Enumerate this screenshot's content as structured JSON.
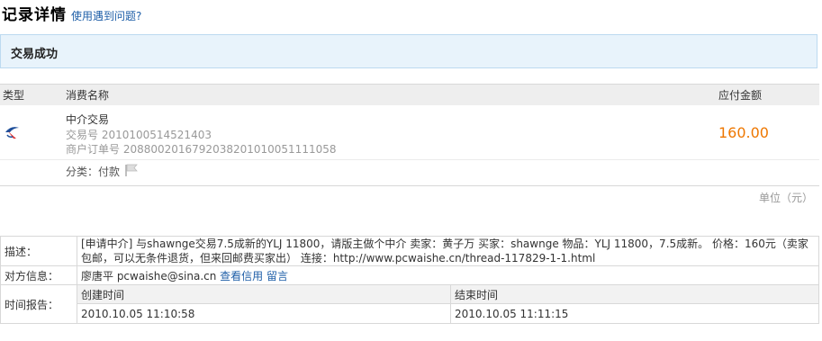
{
  "page": {
    "title": "记录详情",
    "help_link": "使用遇到问题?"
  },
  "status": {
    "text": "交易成功"
  },
  "table": {
    "headers": {
      "type": "类型",
      "name": "消费名称",
      "amount": "应付金额"
    },
    "row": {
      "name": "中介交易",
      "trade_no": "交易号 2010100514521403",
      "merchant_order": "商户订单号 2088002016792038201010051111058",
      "amount": "160.00",
      "category": "分类：付款",
      "icon": "escrow-trade-icon"
    }
  },
  "unit_label": "单位（元）",
  "details": {
    "desc_label": "描述：",
    "desc_text": "[申请中介] 与shawnge交易7.5成新的YLJ 11800，请版主做个中介 卖家：黄子万 买家：shawnge 物品：YLJ 11800，7.5成新。 价格：160元（卖家包邮，可以无条件退货，但来回邮费买家出） 连接：http://www.pcwaishe.cn/thread-117829-1-1.html",
    "party_label": "对方信息：",
    "party_name": "廖唐平  pcwaishe@sina.cn",
    "view_credit": "查看信用",
    "leave_message": "留言",
    "time_label": "时间报告：",
    "created_header": "创建时间",
    "ended_header": "结束时间",
    "created_value": "2010.10.05 11:10:58",
    "ended_value": "2010.10.05 11:11:15"
  },
  "colors": {
    "link": "#1f5fa8",
    "amount": "#ee7700",
    "status_bg": "#e8f3fb"
  }
}
